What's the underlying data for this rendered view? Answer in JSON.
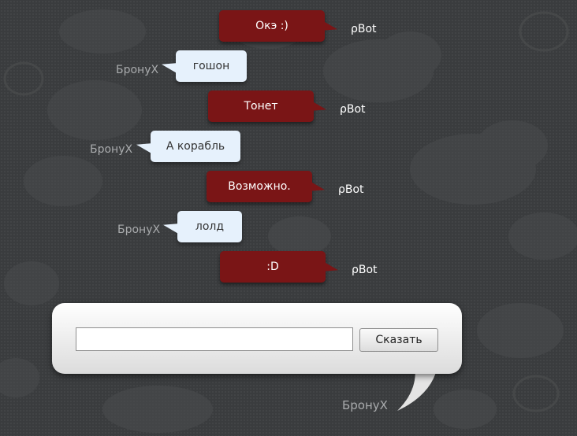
{
  "messages": [
    {
      "role": "bot",
      "author": "ρBot",
      "text": "Окэ :)"
    },
    {
      "role": "user",
      "author": "БронуХ",
      "text": "гошон"
    },
    {
      "role": "bot",
      "author": "ρBot",
      "text": "Тонет"
    },
    {
      "role": "user",
      "author": "БронуХ",
      "text": "А корабль"
    },
    {
      "role": "bot",
      "author": "ρBot",
      "text": "Возможно."
    },
    {
      "role": "user",
      "author": "БронуХ",
      "text": "лолд"
    },
    {
      "role": "bot",
      "author": "ρBot",
      "text": ":D"
    }
  ],
  "composer": {
    "input_value": "",
    "submit_label": "Сказать",
    "author": "БронуХ"
  },
  "colors": {
    "background": "#3a3c3e",
    "bot_bubble": "#7a1516",
    "user_bubble": "#e6f1fc",
    "user_author": "#a9abad"
  }
}
